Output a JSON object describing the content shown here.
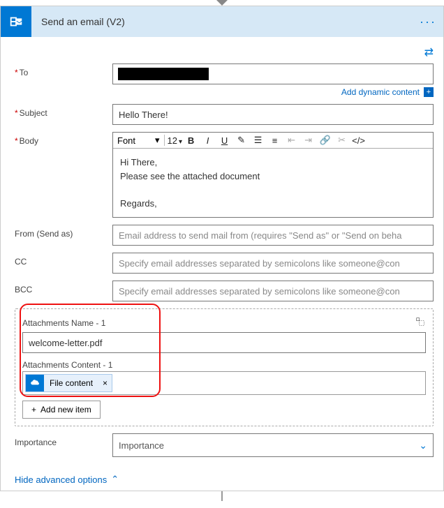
{
  "header": {
    "title": "Send an email (V2)"
  },
  "dynamic": {
    "label": "Add dynamic content"
  },
  "fields": {
    "to": {
      "label": "To"
    },
    "subject": {
      "label": "Subject",
      "value": "Hello There!"
    },
    "body": {
      "label": "Body",
      "content": "Hi There,\nPlease see the attached document\n\nRegards,"
    },
    "from": {
      "label": "From (Send as)",
      "placeholder": "Email address to send mail from (requires \"Send as\" or \"Send on beha"
    },
    "cc": {
      "label": "CC",
      "placeholder": "Specify email addresses separated by semicolons like someone@con"
    },
    "bcc": {
      "label": "BCC",
      "placeholder": "Specify email addresses separated by semicolons like someone@con"
    },
    "importance": {
      "label": "Importance",
      "value": "Importance"
    }
  },
  "toolbar": {
    "font": "Font",
    "size": "12"
  },
  "attachments": {
    "name_label": "Attachments Name - 1",
    "name_value": "welcome-letter.pdf",
    "content_label": "Attachments Content - 1",
    "token_label": "File content",
    "add_label": "Add new item"
  },
  "footer": {
    "hide_advanced": "Hide advanced options"
  }
}
